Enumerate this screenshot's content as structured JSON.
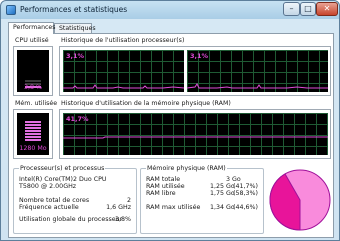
{
  "window": {
    "title": "Performances et statistiques"
  },
  "tabs": [
    {
      "label": "Performances"
    },
    {
      "label": "Statistiques"
    }
  ],
  "cpu": {
    "label": "CPU utilisé",
    "value": "3,8 %",
    "level": 0.038
  },
  "cpu_history": {
    "label": "Historique de l'utilisation processeur(s)",
    "core1_pct": "3,1%",
    "core2_pct": "3,1%"
  },
  "mem": {
    "label": "Mém. utilisée",
    "value": "1280 Mo",
    "level": 0.417
  },
  "mem_history": {
    "label": "Historique d'utilisation de la mémoire physique (RAM)",
    "pct": "41,7%"
  },
  "processor": {
    "title": "Processeur(s) et processus",
    "model": "Intel(R) Core(TM)2 Duo CPU",
    "model2": "T5800  @ 2.00GHz",
    "cores_label": "Nombre total de cores",
    "cores_value": "2",
    "freq_label": "Fréquence actuelle",
    "freq_value": "1,6 GHz",
    "usage_label": "Utilisation globale du processeur",
    "usage_value": "3,8%"
  },
  "memory": {
    "title": "Mémoire physique (RAM)",
    "rows": [
      {
        "label": "RAM totale",
        "value": "3 Go",
        "pct": ""
      },
      {
        "label": "RAM utilisée",
        "value": "1,25 Go",
        "pct": "(41,7%)"
      },
      {
        "label": "RAM libre",
        "value": "1,75 Go",
        "pct": "(58,3%)"
      }
    ],
    "max_label": "RAM max utilisée",
    "max_value": "1,34 Go",
    "max_pct": "(44,6%)"
  },
  "pie": {
    "used_fraction": 0.417,
    "used_color": "#e8149a",
    "free_color": "#f98bdc"
  },
  "colors": {
    "graph_line": "#e04ad8",
    "grid": "#1f5a34",
    "accent": "#e04ad8"
  }
}
